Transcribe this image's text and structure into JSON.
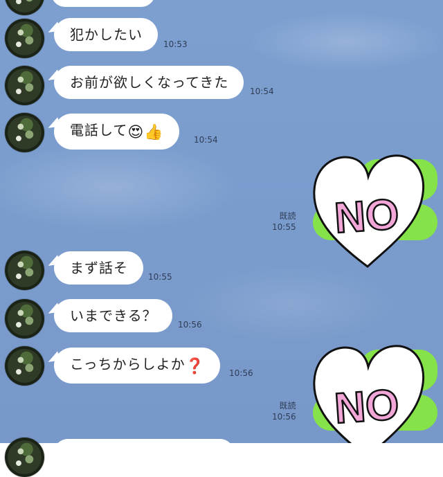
{
  "messages": [
    {
      "id": "m0",
      "text": "",
      "time": ""
    },
    {
      "id": "m1",
      "text": "犯かしたい",
      "time": "10:53"
    },
    {
      "id": "m2",
      "text": "お前が欲しくなってきた",
      "time": "10:54"
    },
    {
      "id": "m3",
      "text": "電話して",
      "emoji": [
        "😍",
        "👍"
      ],
      "time": "10:54"
    },
    {
      "id": "m4",
      "text": "まず話そ",
      "time": "10:55"
    },
    {
      "id": "m5",
      "text": "いまできる？",
      "time": "10:56"
    },
    {
      "id": "m6",
      "text": "こっちからしよか",
      "emoji": [
        "❓"
      ],
      "time": "10:56"
    }
  ],
  "sent": [
    {
      "read_label": "既読",
      "time": "10:55",
      "sticker_text": "NO"
    },
    {
      "read_label": "既読",
      "time": "10:56",
      "sticker_text": "NO"
    }
  ],
  "colors": {
    "background": "#7a9ccd",
    "incoming_bubble": "#ffffff",
    "outgoing_bubble": "#85e249",
    "sticker_text": "#f2a6d8"
  }
}
